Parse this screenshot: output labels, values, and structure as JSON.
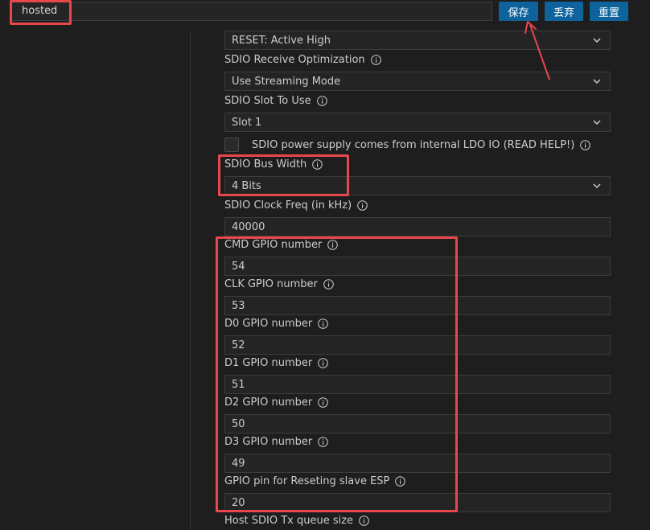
{
  "search": {
    "value": "hosted"
  },
  "toolbar": {
    "save_label": "保存",
    "discard_label": "丢弃",
    "reset_label": "重置"
  },
  "settings": {
    "reset_select": {
      "value": "RESET: Active High"
    },
    "rx_opt": {
      "label": "SDIO Receive Optimization",
      "value": "Use Streaming Mode"
    },
    "slot": {
      "label": "SDIO Slot To Use",
      "value": "Slot 1"
    },
    "ldo": {
      "label": "SDIO power supply comes from internal LDO IO (READ HELP!)",
      "checked": false
    },
    "bus_width": {
      "label": "SDIO Bus Width",
      "value": "4 Bits"
    },
    "clock": {
      "label": "SDIO Clock Freq (in kHz)",
      "value": "40000"
    },
    "cmd": {
      "label": "CMD GPIO number",
      "value": "54"
    },
    "clk": {
      "label": "CLK GPIO number",
      "value": "53"
    },
    "d0": {
      "label": "D0 GPIO number",
      "value": "52"
    },
    "d1": {
      "label": "D1 GPIO number",
      "value": "51"
    },
    "d2": {
      "label": "D2 GPIO number",
      "value": "50"
    },
    "d3": {
      "label": "D3 GPIO number",
      "value": "49"
    },
    "reset_pin": {
      "label": "GPIO pin for Reseting slave ESP",
      "value": "20"
    },
    "tx_queue": {
      "label": "Host SDIO Tx queue size"
    }
  },
  "icons": {
    "info": "info-icon",
    "chevron": "chevron-down-icon"
  },
  "colors": {
    "accent": "#0e639c",
    "annotation": "#e8474c",
    "background": "#1e1e1e"
  }
}
